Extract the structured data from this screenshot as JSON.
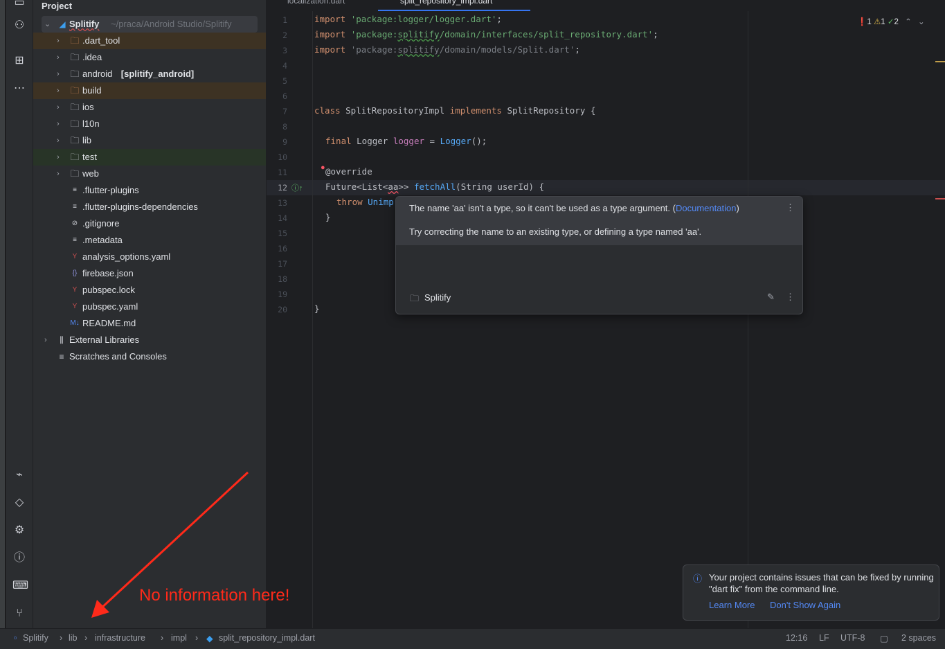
{
  "panel": {
    "title": "Project",
    "root": {
      "name": "Splitify",
      "path": "~/praca/Android Studio/Splitify"
    },
    "items": [
      {
        "name": ".dart_tool",
        "type": "folder-excluded",
        "expandable": true,
        "bg": "brown"
      },
      {
        "name": ".idea",
        "type": "folder-config",
        "expandable": true
      },
      {
        "name": "android",
        "suffix": "[splitify_android]",
        "type": "folder",
        "expandable": true
      },
      {
        "name": "build",
        "type": "folder-excluded",
        "expandable": true,
        "bg": "brown"
      },
      {
        "name": "ios",
        "type": "folder",
        "expandable": true
      },
      {
        "name": "l10n",
        "type": "folder",
        "expandable": true
      },
      {
        "name": "lib",
        "type": "folder-source",
        "expandable": true
      },
      {
        "name": "test",
        "type": "folder-test",
        "expandable": true,
        "bg": "green"
      },
      {
        "name": "web",
        "type": "folder",
        "expandable": true
      },
      {
        "name": ".flutter-plugins",
        "type": "text-file"
      },
      {
        "name": ".flutter-plugins-dependencies",
        "type": "text-file"
      },
      {
        "name": ".gitignore",
        "type": "ignore-file"
      },
      {
        "name": ".metadata",
        "type": "text-file"
      },
      {
        "name": "analysis_options.yaml",
        "type": "yaml-file"
      },
      {
        "name": "firebase.json",
        "type": "json-file"
      },
      {
        "name": "pubspec.lock",
        "type": "yaml-file"
      },
      {
        "name": "pubspec.yaml",
        "type": "yaml-file"
      },
      {
        "name": "README.md",
        "type": "markdown-file"
      }
    ],
    "extra": [
      {
        "name": "External Libraries",
        "icon": "library-icon"
      },
      {
        "name": "Scratches and Consoles",
        "icon": "scratches-icon"
      }
    ]
  },
  "tabs": [
    {
      "label": "localization.dart"
    },
    {
      "label": "split_repository_impl.dart",
      "active": true
    }
  ],
  "editor": {
    "inspections": {
      "errors": "1",
      "warnings": "1",
      "weak": "2"
    },
    "line_numbers": [
      "1",
      "2",
      "3",
      "4",
      "5",
      "6",
      "7",
      "8",
      "9",
      "10",
      "11",
      "12",
      "13",
      "14",
      "15",
      "16",
      "17",
      "18",
      "19",
      "20"
    ],
    "code": {
      "l1a": "import ",
      "l1b": "'package:logger/logger.dart'",
      "l1c": ";",
      "l2a": "import ",
      "l2b": "'package:",
      "l2c": "splitify",
      "l2d": "/domain/interfaces/split_repository.dart'",
      "l2e": ";",
      "l3a": "import ",
      "l3b": "'package:",
      "l3c": "splitify",
      "l3d": "/domain/models/Split.dart'",
      "l3e": ";",
      "l7a": "class ",
      "l7b": "SplitRepositoryImpl ",
      "l7c": "implements ",
      "l7d": "SplitRepository {",
      "l9a": "final ",
      "l9b": "Logger ",
      "l9c": "logger",
      "l9d": " = ",
      "l9e": "Logger",
      "l9f": "();",
      "l11": "@override",
      "l12a": "Future<List<",
      "l12b": "aa",
      "l12c": ">> ",
      "l12d": "fetchAll",
      "l12e": "(String userId) {",
      "l13a": "throw ",
      "l13b": "Unimp",
      "l14": "}",
      "l20": "}"
    }
  },
  "tooltip": {
    "message": "The name 'aa' isn't a type, so it can't be used as a type argument. (",
    "link": "Documentation",
    "close_paren": ")",
    "hint": "Try correcting the name to an existing type, or defining a type named 'aa'.",
    "project": "Splitify"
  },
  "notification": {
    "text": "Your project contains issues that can be fixed by running \"dart fix\" from the command line.",
    "learn_more": "Learn More",
    "dont_show": "Don't Show Again"
  },
  "annotation": {
    "text": "No information here!",
    "color": "#ff2a1a"
  },
  "status": {
    "breadcrumb": [
      "Splitify",
      "lib",
      "infrastructure",
      "impl",
      "split_repository_impl.dart"
    ],
    "position": "12:16",
    "line_sep": "LF",
    "encoding": "UTF-8",
    "indent": "2 spaces"
  }
}
